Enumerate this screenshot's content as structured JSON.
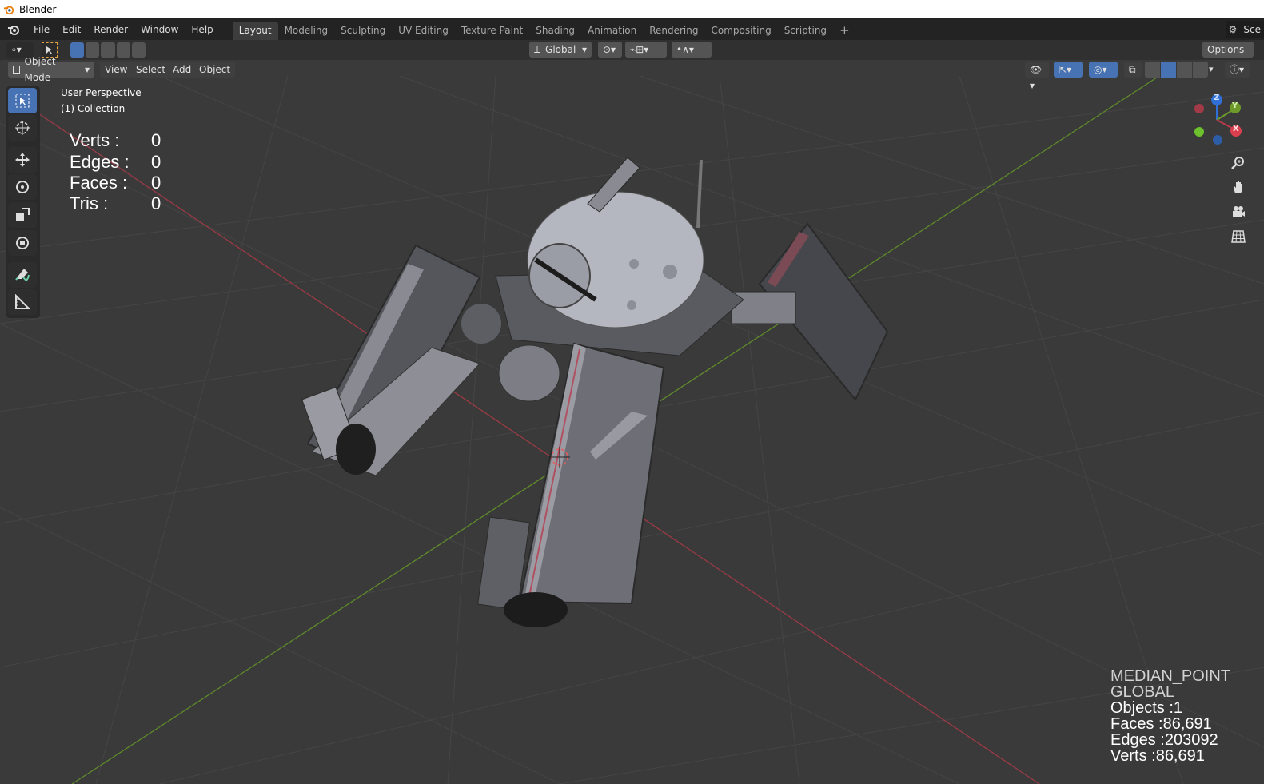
{
  "window": {
    "title": "Blender"
  },
  "menu": [
    "File",
    "Edit",
    "Render",
    "Window",
    "Help"
  ],
  "workspaces": [
    "Layout",
    "Modeling",
    "Sculpting",
    "UV Editing",
    "Texture Paint",
    "Shading",
    "Animation",
    "Rendering",
    "Compositing",
    "Scripting"
  ],
  "scene_label": "Sce",
  "toolbar": {
    "orientation": "Global",
    "options_label": "Options"
  },
  "viewport_header": {
    "mode": "Object Mode",
    "menus": [
      "View",
      "Select",
      "Add",
      "Object"
    ]
  },
  "viewport": {
    "perspective": "User Perspective",
    "collection": "(1) Collection"
  },
  "selection_stats": {
    "rows": [
      {
        "label": "Verts :",
        "value": "0"
      },
      {
        "label": "Edges :",
        "value": "0"
      },
      {
        "label": "Faces :",
        "value": "0"
      },
      {
        "label": "Tris :",
        "value": "0"
      }
    ]
  },
  "scene_stats": {
    "pivot": "MEDIAN_POINT",
    "orientation": "GLOBAL",
    "objects": "Objects :1",
    "faces": "Faces :86,691",
    "edges": "Edges :203092",
    "verts": "Verts :86,691"
  },
  "gizmo": {
    "x": "X",
    "y": "Y",
    "z": "Z"
  },
  "colors": {
    "accent": "#4772b3",
    "x_axis": "#b83a4b",
    "y_axis": "#6d9a2b",
    "z_axis": "#2f6fd6"
  },
  "icons": [
    "blender-logo-icon",
    "select-box-icon",
    "cursor-icon",
    "move-icon",
    "rotate-icon",
    "scale-icon",
    "transform-icon",
    "annotate-icon",
    "measure-icon",
    "zoom-icon",
    "pan-hand-icon",
    "camera-icon",
    "grid-icon"
  ]
}
